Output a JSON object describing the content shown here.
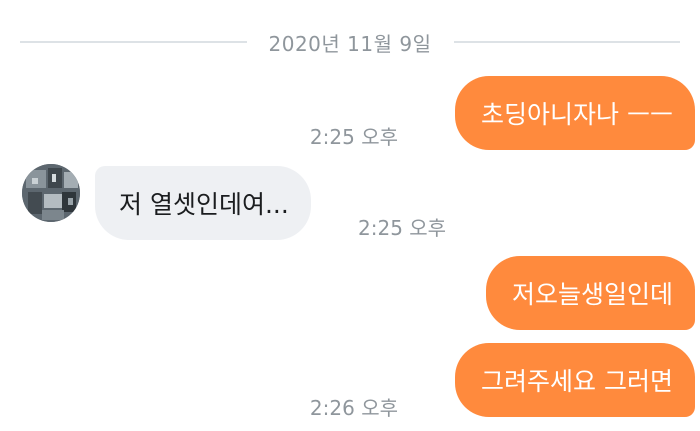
{
  "chat": {
    "date_divider": "2020년 11월 9일",
    "messages": [
      {
        "direction": "outgoing",
        "text": "초딩아니자나 ㅡㅡ",
        "time": "2:25 오후"
      },
      {
        "direction": "incoming",
        "text": "저 열셋인데여...",
        "time": "2:25 오후"
      },
      {
        "direction": "outgoing",
        "text": "저오늘생일인데",
        "time": ""
      },
      {
        "direction": "outgoing",
        "text": "그려주세요 그러면",
        "time": "2:26 오후"
      }
    ]
  },
  "colors": {
    "outgoing_bubble": "#ff8a3d",
    "incoming_bubble": "#eef0f3",
    "timestamp": "#8f969c",
    "divider_line": "#dde2e6"
  },
  "icons": {
    "sender_avatar": "avatar-photo"
  }
}
